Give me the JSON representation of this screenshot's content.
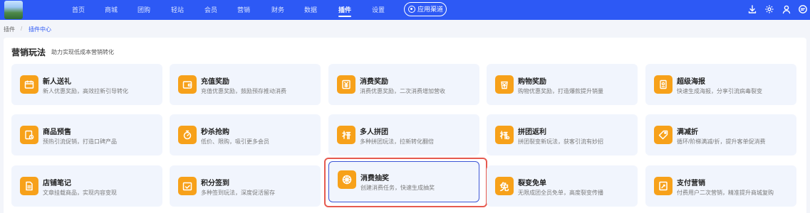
{
  "topbar": {
    "logo": "landscape-logo",
    "nav": [
      "首页",
      "商城",
      "团购",
      "轻站",
      "会员",
      "营销",
      "财务",
      "数据",
      "插件",
      "设置"
    ],
    "active_nav": "插件",
    "app_market": "应用渠道",
    "right_icons": [
      "download-icon",
      "gear-icon",
      "user-icon",
      "message-icon"
    ]
  },
  "breadcrumb": {
    "root": "插件",
    "separator": "/",
    "current": "插件中心"
  },
  "section": {
    "title": "营销玩法",
    "subtitle": "助力实现低成本营销转化"
  },
  "cards": [
    {
      "title": "新人送礼",
      "desc": "新人优惠奖励，高效拉新引导转化",
      "icon": "calendar-gift-icon"
    },
    {
      "title": "充值奖励",
      "desc": "充值优惠奖励，鼓励预存推动消费",
      "icon": "wallet-icon"
    },
    {
      "title": "消费奖励",
      "desc": "消费优惠奖励，二次消费增加营收",
      "icon": "yen-note-icon"
    },
    {
      "title": "购物奖励",
      "desc": "购物优惠奖励，打造爆款提升销量",
      "icon": "yen-bag-icon"
    },
    {
      "title": "超级海报",
      "desc": "快速生成海报，分享引流病毒裂变",
      "icon": "poster-icon"
    },
    {
      "title": "商品预售",
      "desc": "预热引流促销，打造口碑产品",
      "icon": "presale-icon"
    },
    {
      "title": "秒杀抢购",
      "desc": "低价、限购，吸引更多会员",
      "icon": "stopwatch-icon"
    },
    {
      "title": "多人拼团",
      "desc": "多种拼团玩法，拉新转化翻倍",
      "icon": "group-buy-icon"
    },
    {
      "title": "拼团返利",
      "desc": "拼团裂变新玩法，获客引流有妙招",
      "icon": "group-rebate-icon"
    },
    {
      "title": "满减折",
      "desc": "循环/阶梯满减/折，提升客单促消费",
      "icon": "tag-icon"
    },
    {
      "title": "店铺笔记",
      "desc": "文章挂载商品，实现内容变现",
      "icon": "note-icon"
    },
    {
      "title": "积分签到",
      "desc": "多种签到玩法，深度促活留存",
      "icon": "checkin-icon"
    },
    {
      "title": "消费抽奖",
      "desc": "创建消费任务，快速生成抽奖",
      "icon": "wheel-icon"
    },
    {
      "title": "裂变免单",
      "desc": "无限成团全员免单，高度裂变传播",
      "icon": "free-icon"
    },
    {
      "title": "支付营销",
      "desc": "付费用户二次营销，精准提升商城复购",
      "icon": "pay-marketing-icon"
    }
  ],
  "free_icon_glyph": "免",
  "colors": {
    "topbar": "#2d59f5",
    "accent": "#2d59f5",
    "icon_bg": "#f7a11a",
    "card_bg": "#f1f5fd",
    "focus_outline": "#e65a4f"
  }
}
